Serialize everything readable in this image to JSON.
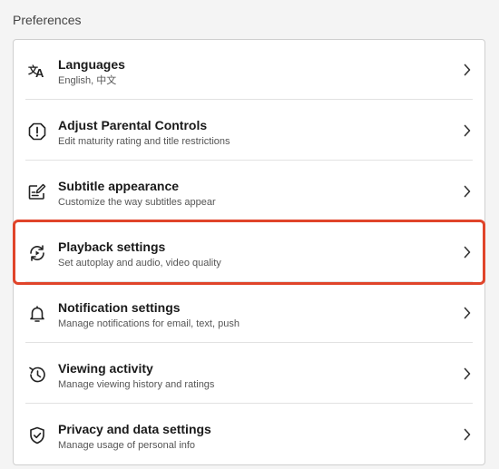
{
  "section": {
    "title": "Preferences"
  },
  "accent": {
    "highlight_color": "#e0442a"
  },
  "items": [
    {
      "title": "Languages",
      "subtitle": "English, 中文",
      "icon": "translate-icon"
    },
    {
      "title": "Adjust Parental Controls",
      "subtitle": "Edit maturity rating and title restrictions",
      "icon": "alert-octagon-icon"
    },
    {
      "title": "Subtitle appearance",
      "subtitle": "Customize the way subtitles appear",
      "icon": "subtitle-edit-icon"
    },
    {
      "title": "Playback settings",
      "subtitle": "Set autoplay and audio, video quality",
      "icon": "playback-cycle-icon",
      "highlighted": true
    },
    {
      "title": "Notification settings",
      "subtitle": "Manage notifications for email, text, push",
      "icon": "bell-icon"
    },
    {
      "title": "Viewing activity",
      "subtitle": "Manage viewing history and ratings",
      "icon": "history-icon"
    },
    {
      "title": "Privacy and data settings",
      "subtitle": "Manage usage of personal info",
      "icon": "shield-check-icon"
    }
  ]
}
